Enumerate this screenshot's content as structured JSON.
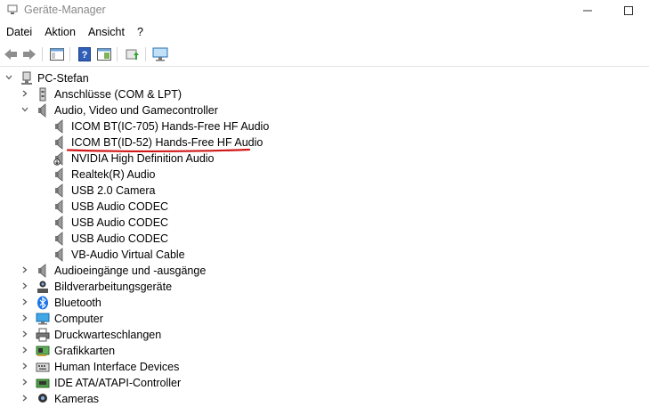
{
  "window": {
    "title": "Geräte-Manager"
  },
  "menu": [
    "Datei",
    "Aktion",
    "Ansicht",
    "?"
  ],
  "toolbar": {
    "buttons": [
      "back-icon",
      "forward-icon",
      "properties-icon",
      "help-icon",
      "show-hide-icon",
      "update-driver-icon",
      "monitor-icon"
    ]
  },
  "tree": {
    "root": "PC-Stefan",
    "items": [
      {
        "label": "Anschlüsse (COM & LPT)",
        "icon": "port-icon",
        "expanded": false
      },
      {
        "label": "Audio, Video und Gamecontroller",
        "icon": "speaker-icon",
        "expanded": true,
        "children": [
          "ICOM BT(IC-705) Hands-Free HF Audio",
          "ICOM BT(ID-52) Hands-Free HF Audio",
          "NVIDIA High Definition Audio",
          "Realtek(R) Audio",
          "USB 2.0 Camera",
          "USB Audio CODEC",
          "USB Audio CODEC",
          "USB Audio CODEC",
          "VB-Audio Virtual Cable"
        ]
      },
      {
        "label": "Audioeingänge und -ausgänge",
        "icon": "speaker-icon",
        "expanded": false
      },
      {
        "label": "Bildverarbeitungsgeräte",
        "icon": "camera-icon",
        "expanded": false
      },
      {
        "label": "Bluetooth",
        "icon": "bluetooth-icon",
        "expanded": false
      },
      {
        "label": "Computer",
        "icon": "computer-icon",
        "expanded": false
      },
      {
        "label": "Druckwarteschlangen",
        "icon": "printer-icon",
        "expanded": false
      },
      {
        "label": "Grafikkarten",
        "icon": "display-adapter-icon",
        "expanded": false
      },
      {
        "label": "Human Interface Devices",
        "icon": "keyboard-icon",
        "expanded": false
      },
      {
        "label": "IDE ATA/ATAPI-Controller",
        "icon": "ide-controller-icon",
        "expanded": false
      },
      {
        "label": "Kameras",
        "icon": "webcam-icon",
        "expanded": false
      }
    ]
  },
  "colors": {
    "highlight_underline": "#d01818",
    "bluetooth": "#1a73e8"
  }
}
